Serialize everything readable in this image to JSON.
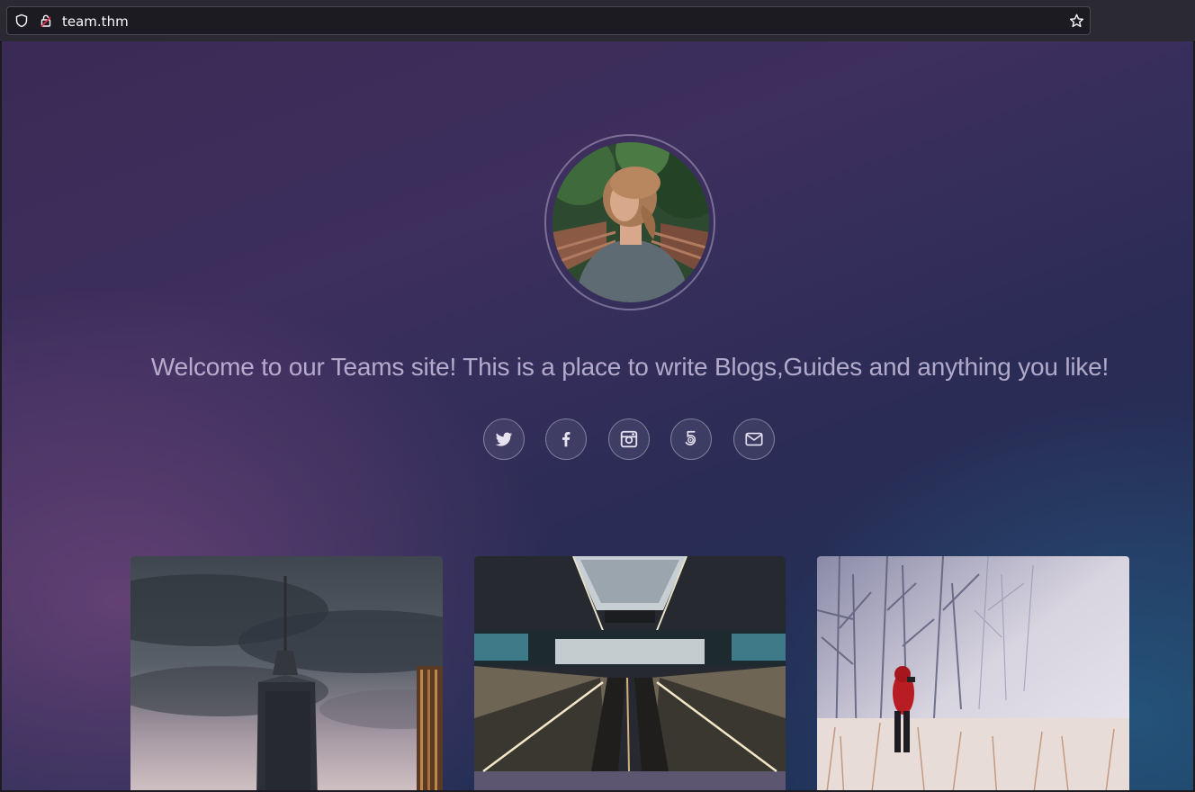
{
  "browser": {
    "url": "team.thm",
    "icons": [
      "shield-icon",
      "lock-icon",
      "star-icon"
    ]
  },
  "hero": {
    "avatar_icon": "avatar",
    "welcome_text": "Welcome to our Teams site! This is a place to write Blogs,Guides and anything you like!"
  },
  "socials": [
    {
      "icon": "twitter-icon"
    },
    {
      "icon": "facebook-icon"
    },
    {
      "icon": "instagram-icon"
    },
    {
      "icon": "500px-icon"
    },
    {
      "icon": "email-icon"
    }
  ],
  "cards": [
    {
      "image": "city-skyscraper-photo"
    },
    {
      "image": "escalator-station-photo"
    },
    {
      "image": "snowy-forest-person-photo"
    }
  ],
  "colors": {
    "toolbar": "#2b2a33",
    "url_text": "#fbfbfe",
    "bg_purple": "#3d2f5e",
    "bg_blue": "#1d3358"
  }
}
